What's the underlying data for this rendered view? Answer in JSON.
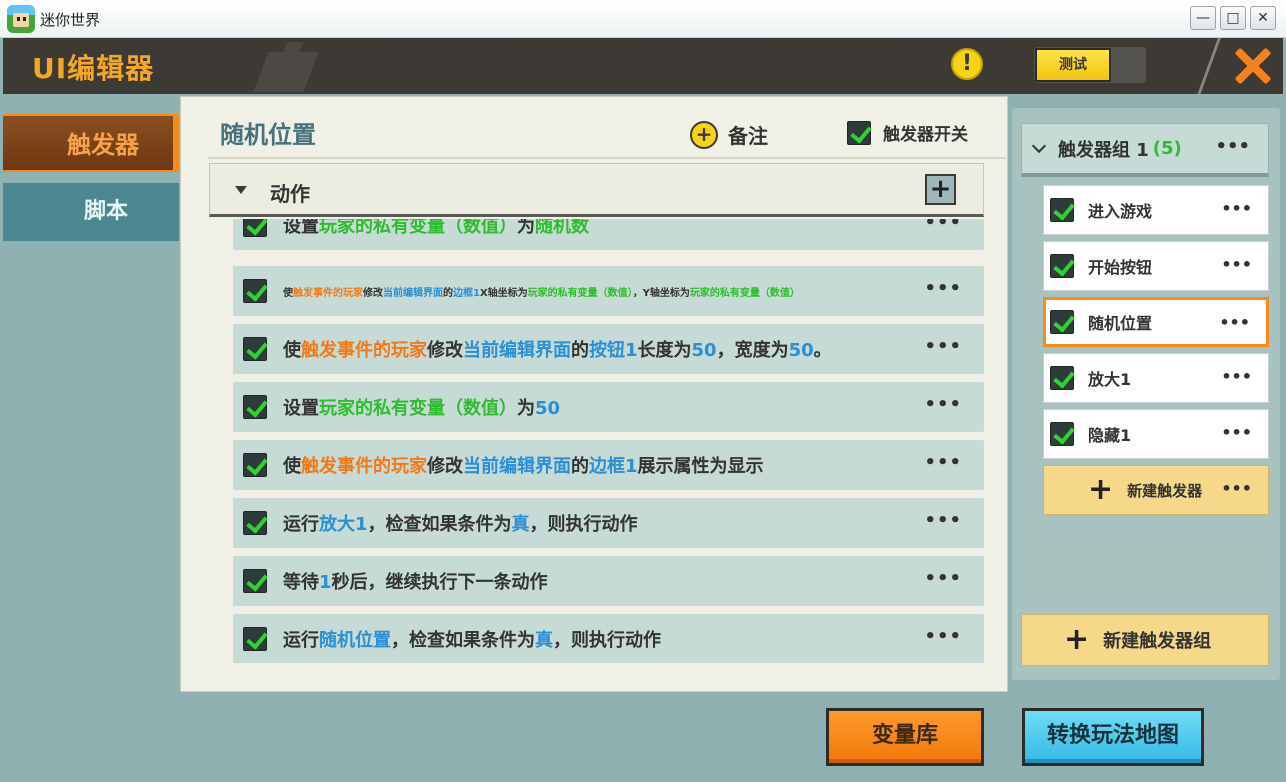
{
  "window": {
    "title": "迷你世界",
    "minimize": "—",
    "maximize": "□",
    "close": "✕"
  },
  "header": {
    "title": "UI编辑器",
    "warning_symbol": "!",
    "test_label": "测试"
  },
  "sidebar": {
    "items": [
      {
        "label": "触发器",
        "active": true
      },
      {
        "label": "脚本",
        "active": false
      }
    ]
  },
  "main": {
    "title": "随机位置",
    "note_plus": "+",
    "note_label": "备注",
    "trigger_switch_label": "触发器开关",
    "section": {
      "label": "动作",
      "add_symbol": "+"
    },
    "more_symbol": "•••",
    "actions": [
      {
        "parts": [
          {
            "t": "设置"
          },
          {
            "t": "玩家的私有变量（数值）",
            "c": "g"
          },
          {
            "t": "为"
          },
          {
            "t": "随机数",
            "c": "g"
          }
        ]
      },
      {
        "small": true,
        "parts": [
          {
            "t": "使"
          },
          {
            "t": "触发事件的玩家",
            "c": "o"
          },
          {
            "t": "修改"
          },
          {
            "t": "当前编辑界面",
            "c": "b"
          },
          {
            "t": "的"
          },
          {
            "t": "边框1",
            "c": "b"
          },
          {
            "t": "X轴坐标为"
          },
          {
            "t": "玩家的私有变量（数值）",
            "c": "g"
          },
          {
            "t": "，Y轴坐标为"
          },
          {
            "t": "玩家的私有变量（数值）",
            "c": "g"
          }
        ]
      },
      {
        "parts": [
          {
            "t": "使"
          },
          {
            "t": "触发事件的玩家",
            "c": "o"
          },
          {
            "t": "修改"
          },
          {
            "t": "当前编辑界面",
            "c": "b"
          },
          {
            "t": "的"
          },
          {
            "t": "按钮1",
            "c": "b"
          },
          {
            "t": "长度为"
          },
          {
            "t": "50",
            "c": "b"
          },
          {
            "t": "，宽度为"
          },
          {
            "t": "50",
            "c": "b"
          },
          {
            "t": "。"
          }
        ]
      },
      {
        "parts": [
          {
            "t": "设置"
          },
          {
            "t": "玩家的私有变量（数值）",
            "c": "g"
          },
          {
            "t": "为"
          },
          {
            "t": "50",
            "c": "b"
          }
        ]
      },
      {
        "parts": [
          {
            "t": "使"
          },
          {
            "t": "触发事件的玩家",
            "c": "o"
          },
          {
            "t": "修改"
          },
          {
            "t": "当前编辑界面",
            "c": "b"
          },
          {
            "t": "的"
          },
          {
            "t": "边框1",
            "c": "b"
          },
          {
            "t": "展示属性为显示"
          }
        ]
      },
      {
        "parts": [
          {
            "t": "运行"
          },
          {
            "t": "放大1",
            "c": "b"
          },
          {
            "t": "，检查如果条件为"
          },
          {
            "t": "真",
            "c": "b"
          },
          {
            "t": "，则执行动作"
          }
        ]
      },
      {
        "parts": [
          {
            "t": "等待"
          },
          {
            "t": "1",
            "c": "b"
          },
          {
            "t": "秒后，继续执行下一条动作"
          }
        ]
      },
      {
        "parts": [
          {
            "t": "运行"
          },
          {
            "t": "随机位置",
            "c": "b"
          },
          {
            "t": "，检查如果条件为"
          },
          {
            "t": "真",
            "c": "b"
          },
          {
            "t": "，则执行动作"
          }
        ]
      }
    ]
  },
  "right": {
    "group": {
      "label": "触发器组 1",
      "count": "(5)"
    },
    "triggers": [
      {
        "label": "进入游戏",
        "selected": false
      },
      {
        "label": "开始按钮",
        "selected": false
      },
      {
        "label": "随机位置",
        "selected": true
      },
      {
        "label": "放大1",
        "selected": false
      },
      {
        "label": "隐藏1",
        "selected": false
      }
    ],
    "new_trigger_label": "新建触发器",
    "new_group_label": "新建触发器组",
    "plus_symbol": "+"
  },
  "bottom": {
    "variables_label": "变量库",
    "convert_label": "转换玩法地图"
  },
  "colors": {
    "accent_orange": "#f58b1e",
    "highlight_orange": "#f07a1b",
    "highlight_blue": "#2b8fd4",
    "highlight_green": "#2ebd2e",
    "check_green": "#33d033",
    "header_dark": "#3d3a36"
  },
  "icons": [
    "app-icon",
    "warning-icon",
    "close-icon",
    "plus-icon",
    "checkbox-icon",
    "collapse-triangle-icon",
    "chevron-down-icon",
    "more-icon"
  ]
}
